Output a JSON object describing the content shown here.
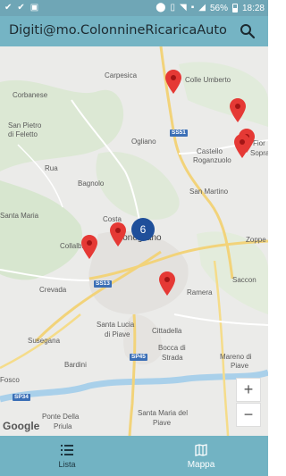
{
  "status_bar": {
    "battery": "56%",
    "time": "18:28"
  },
  "app_bar": {
    "title": "Digiti@mo.ColonnineRicaricaAuto",
    "search_icon": "search-icon"
  },
  "map": {
    "places": {
      "carpesica": "Carpesica",
      "colle_umberto": "Colle Umberto",
      "corbanese": "Corbanese",
      "san_pietro": "San Pietro",
      "di_feletto": "di Feletto",
      "ogliano": "Ogliano",
      "castello": "Castello",
      "roganzuolo": "Roganzuolo",
      "fior": "Fior",
      "sopra": "Sopra",
      "rua": "Rua",
      "bagnolo": "Bagnolo",
      "san_martino": "San Martino",
      "santa_maria": "Santa Maria",
      "costa": "Costa",
      "conegliano": "Conegliano",
      "zoppe": "Zoppe",
      "collalbrigo": "Collalbrigo",
      "saccon": "Saccon",
      "crevada": "Crevada",
      "ramera": "Ramera",
      "santa_lucia": "Santa Lucia",
      "di_piave": "di Piave",
      "susegana": "Susegana",
      "cittadella": "Cittadella",
      "bocca_di": "Bocca di",
      "strada": "Strada",
      "bardini": "Bardini",
      "mareno": "Mareno di",
      "mareno_piave": "Piave",
      "fosco": "Fosco",
      "ponte": "Ponte Della",
      "priula": "Priula",
      "santa_maria_del": "Santa Maria del",
      "santa_maria_piave": "Piave"
    },
    "road_shields": {
      "ss51": "SS51",
      "ss13": "SS13",
      "sp45": "SP45",
      "sp34": "SP34"
    },
    "cluster_count": "6",
    "zoom_in": "+",
    "zoom_out": "−",
    "attribution": "Google",
    "marker_color": "#e53935"
  },
  "bottom_nav": {
    "tabs": [
      {
        "label": "Lista",
        "icon": "list-icon",
        "active": false
      },
      {
        "label": "Mappa",
        "icon": "map-icon",
        "active": true
      }
    ]
  }
}
